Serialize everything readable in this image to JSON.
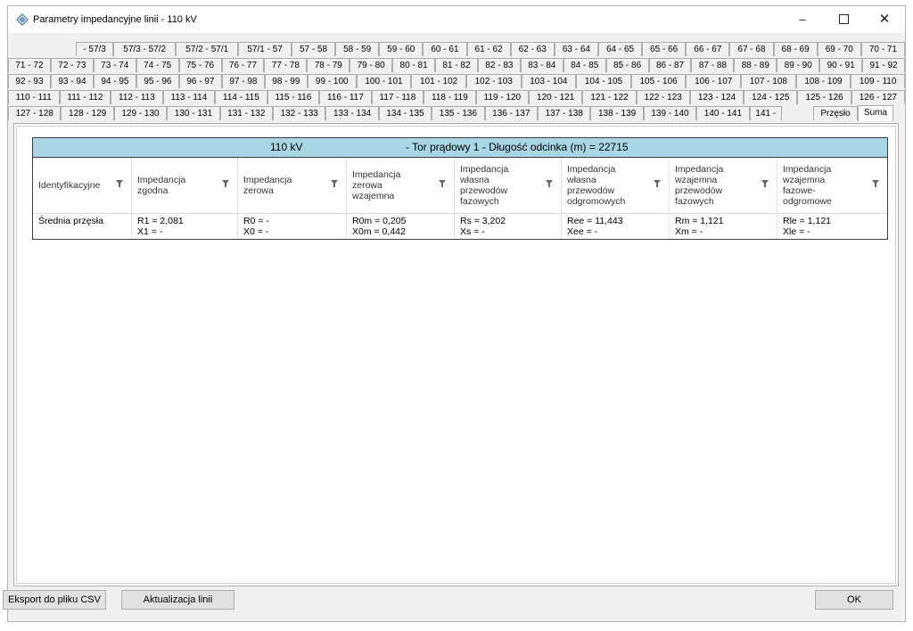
{
  "window": {
    "title": "Parametry impedancyjne linii - 110 kV",
    "controls": {
      "minimize": "–",
      "close": "✕"
    }
  },
  "tabs": {
    "row1": [
      "- 57/3",
      "57/3 - 57/2",
      "57/2 - 57/1",
      "57/1 - 57",
      "57 - 58",
      "58 - 59",
      "59 - 60",
      "60 - 61",
      "61 - 62",
      "62 - 63",
      "63 - 64",
      "64 - 65",
      "65 - 66",
      "66 - 67",
      "67 - 68",
      "68 - 69",
      "69 - 70",
      "70 - 71"
    ],
    "row2": [
      "71 - 72",
      "72 - 73",
      "73 - 74",
      "74 - 75",
      "75 - 76",
      "76 - 77",
      "77 - 78",
      "78 - 79",
      "79 - 80",
      "80 - 81",
      "81 - 82",
      "82 - 83",
      "83 - 84",
      "84 - 85",
      "85 - 86",
      "86 - 87",
      "87 - 88",
      "88 - 89",
      "89 - 90",
      "90 - 91",
      "91 - 92"
    ],
    "row3": [
      "92 - 93",
      "93 - 94",
      "94 - 95",
      "95 - 96",
      "96 - 97",
      "97 - 98",
      "98 - 99",
      "99 - 100",
      "100 - 101",
      "101 - 102",
      "102 - 103",
      "103 - 104",
      "104 - 105",
      "105 - 106",
      "106 - 107",
      "107 - 108",
      "108 - 109",
      "109 - 110"
    ],
    "row4": [
      "110 - 111",
      "111 - 112",
      "112 - 113",
      "113 - 114",
      "114 - 115",
      "115 - 116",
      "116 - 117",
      "117 - 118",
      "118 - 119",
      "119 - 120",
      "120 - 121",
      "121 - 122",
      "122 - 123",
      "123 - 124",
      "124 - 125",
      "125 - 126",
      "126 - 127"
    ],
    "row5": [
      "127 - 128",
      "128 - 129",
      "129 - 130",
      "130 - 131",
      "131 - 132",
      "132 - 133",
      "133 - 134",
      "134 - 135",
      "135 - 136",
      "136 - 137",
      "137 - 138",
      "138 - 139",
      "139 - 140",
      "140 - 141",
      "141 -"
    ],
    "przeslo": "Przęsło",
    "suma": "Suma",
    "active": "Suma"
  },
  "grid": {
    "band_voltage": "110 kV",
    "band_text": "- Tor prądowy 1 - Długość odcinka (m) = 22715",
    "headers": [
      "Identyfikacyjne",
      "Impedancja\nzgodna",
      "Impedancja\nzerowa",
      "Impedancja\nzerowa\nwzajemna",
      "Impedancja\nwłasna\nprzewodów\nfazowych",
      "Impedancja\nwłasna\nprzewodów\nodgromowych",
      "Impedancja\nwzajemna\nprzewodów\nfazowych",
      "Impedancja\nwzajemna\nfazowe-\nodgromowe"
    ],
    "row": [
      "Średnia przęsła",
      "R1 = 2,081\nX1 = -",
      "R0 = -\nX0 = -",
      "R0m = 0,205\nX0m = 0,442",
      "Rs = 3,202\nXs = -",
      "Ree = 11,443\nXee = -",
      "Rm = 1,121\nXm = -",
      "Rle = 1,121\nXle = -"
    ]
  },
  "buttons": {
    "export": "Eksport do pliku CSV",
    "update": "Aktualizacja linii",
    "ok": "OK"
  }
}
